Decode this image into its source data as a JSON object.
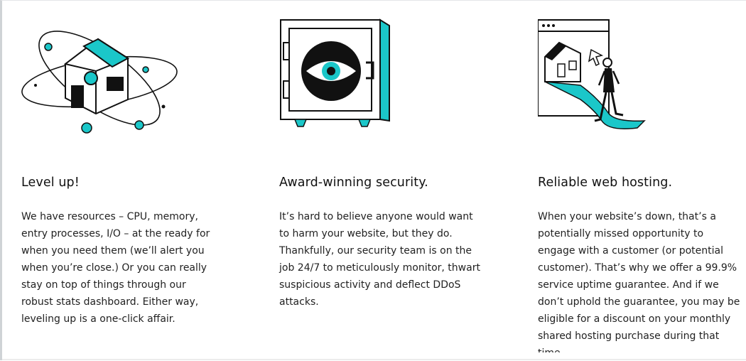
{
  "features": [
    {
      "title": "Level up!",
      "body": "We have resources – CPU, memory, entry processes, I/O – at the ready for when you need them (we’ll alert you when you’re close.) Or you can really stay on top of things through our robust stats dashboard. Either way, leveling up is a one-click affair."
    },
    {
      "title": "Award-winning security.",
      "body": "It’s hard to believe anyone would want to harm your website, but they do. Thankfully, our security team is on the job 24/7 to meticulously monitor, thwart suspicious activity and deflect DDoS attacks."
    },
    {
      "title": "Reliable web hosting.",
      "body": "When your website’s down, that’s a potentially missed opportunity to engage with a customer (or potential customer). That’s why we offer a 99.9% service uptime guarantee. And if we don’t uphold the guarantee, you may be eligible for a discount on your monthly shared hosting purchase during that time."
    }
  ],
  "colors": {
    "accent": "#1bc7c9",
    "ink": "#111111"
  },
  "icons": [
    "house-orbit-illustration",
    "vault-eye-illustration",
    "browser-walker-illustration"
  ]
}
